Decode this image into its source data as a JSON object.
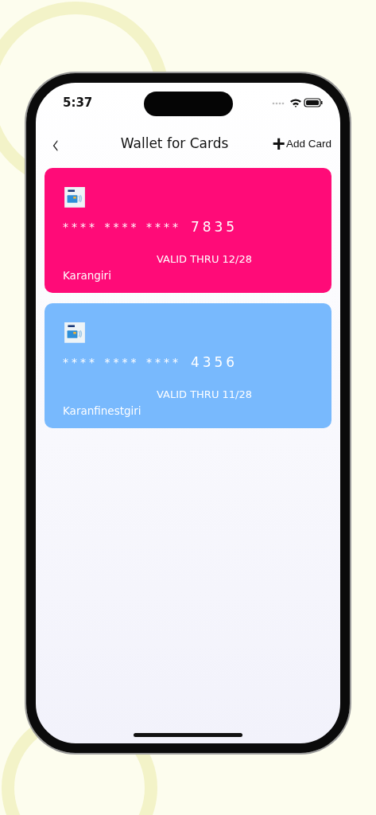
{
  "status_bar": {
    "time": "5:37"
  },
  "header": {
    "back": "‹",
    "title": "Wallet for Cards",
    "action_icon": "+",
    "action": "Add Card"
  },
  "cards": [
    {
      "masked": "**** **** ****",
      "last4": "7835",
      "valid": "VALID THRU 12/28",
      "holder": "Karangiri",
      "color": "#ff0b78"
    },
    {
      "masked": "**** **** ****",
      "last4": "4356",
      "valid": "VALID THRU 11/28",
      "holder": "Karanfinestgiri",
      "color": "#78b9fd"
    }
  ]
}
